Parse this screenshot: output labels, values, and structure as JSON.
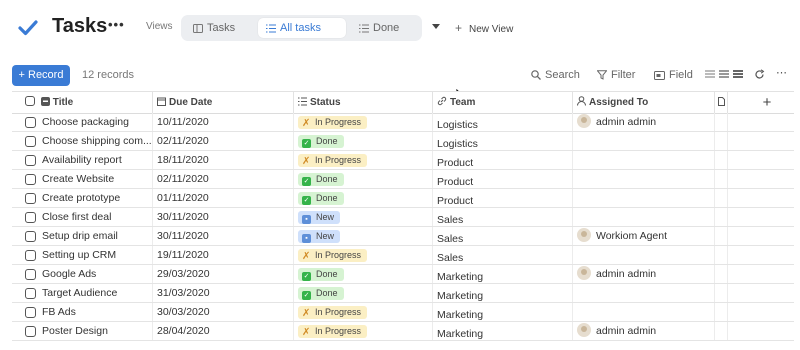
{
  "app": {
    "title": "Tasks",
    "more_label": "•••",
    "views_label": "Views",
    "views": [
      {
        "label": "Tasks",
        "icon": "table-icon"
      },
      {
        "label": "All tasks",
        "icon": "list-icon",
        "active": true
      },
      {
        "label": "Done",
        "icon": "list-icon"
      }
    ],
    "new_view_plus": "+",
    "new_view_label": "New View",
    "accent_color": "#3a7bd5"
  },
  "toolbar": {
    "record_label": "+ Record",
    "record_count": "12 records",
    "search_label": "Search",
    "filter_label": "Filter",
    "field_label": "Field"
  },
  "columns": {
    "title": "Title",
    "due_date": "Due Date",
    "status": "Status",
    "team": "Team",
    "assigned_to": "Assigned To",
    "add_col": "+"
  },
  "status_colors": {
    "In Progress": "#fbefc4",
    "Done": "#d6f3d2",
    "New": "#cfe0fb"
  },
  "rows": [
    {
      "title": "Choose packaging",
      "due": "10/11/2020",
      "status": "In Progress",
      "team": "Logistics",
      "assigned": "admin admin"
    },
    {
      "title": "Choose shipping com...",
      "due": "02/11/2020",
      "status": "Done",
      "team": "Logistics",
      "assigned": ""
    },
    {
      "title": "Availability report",
      "due": "18/11/2020",
      "status": "In Progress",
      "team": "Product",
      "assigned": ""
    },
    {
      "title": "Create Website",
      "due": "02/11/2020",
      "status": "Done",
      "team": "Product",
      "assigned": ""
    },
    {
      "title": "Create prototype",
      "due": "01/11/2020",
      "status": "Done",
      "team": "Product",
      "assigned": ""
    },
    {
      "title": "Close first deal",
      "due": "30/11/2020",
      "status": "New",
      "team": "Sales",
      "assigned": ""
    },
    {
      "title": "Setup drip email",
      "due": "30/11/2020",
      "status": "New",
      "team": "Sales",
      "assigned": "Workiom Agent"
    },
    {
      "title": "Setting up CRM",
      "due": "19/11/2020",
      "status": "In Progress",
      "team": "Sales",
      "assigned": ""
    },
    {
      "title": "Google Ads",
      "due": "29/03/2020",
      "status": "Done",
      "team": "Marketing",
      "assigned": "admin admin"
    },
    {
      "title": "Target Audience",
      "due": "31/03/2020",
      "status": "Done",
      "team": "Marketing",
      "assigned": ""
    },
    {
      "title": "FB Ads",
      "due": "30/03/2020",
      "status": "In Progress",
      "team": "Marketing",
      "assigned": ""
    },
    {
      "title": "Poster Design",
      "due": "28/04/2020",
      "status": "In Progress",
      "team": "Marketing",
      "assigned": "admin admin"
    }
  ]
}
